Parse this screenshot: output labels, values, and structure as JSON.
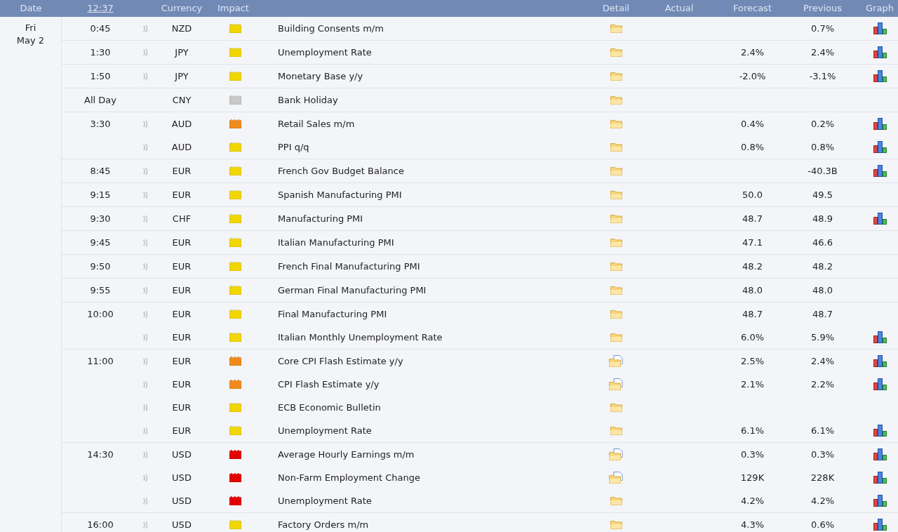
{
  "header": {
    "columns": [
      "Date",
      "12:37",
      "Currency",
      "Impact",
      "Detail",
      "Actual",
      "Forecast",
      "Previous",
      "Graph"
    ]
  },
  "day": {
    "weekday": "Fri",
    "date": "May 2"
  },
  "groups": [
    {
      "time": "0:45",
      "sound": true,
      "events": [
        {
          "currency": "NZD",
          "color": "#f2d600",
          "title": "Building Consents m/m",
          "attachment": false,
          "previous": "0.7%",
          "graph": true
        }
      ]
    },
    {
      "time": "1:30",
      "sound": true,
      "events": [
        {
          "currency": "JPY",
          "color": "#f2d600",
          "title": "Unemployment Rate",
          "attachment": false,
          "forecast": "2.4%",
          "previous": "2.4%",
          "graph": true
        }
      ]
    },
    {
      "time": "1:50",
      "sound": true,
      "events": [
        {
          "currency": "JPY",
          "color": "#f2d600",
          "title": "Monetary Base y/y",
          "attachment": false,
          "forecast": "-2.0%",
          "previous": "-3.1%",
          "graph": true
        }
      ]
    },
    {
      "time": "All Day",
      "sound": false,
      "events": [
        {
          "currency": "CNY",
          "color": "#c8c8c8",
          "title": "Bank Holiday",
          "attachment": false,
          "graph": false
        }
      ]
    },
    {
      "time": "3:30",
      "sound": true,
      "events": [
        {
          "currency": "AUD",
          "color": "#f08a1c",
          "title": "Retail Sales m/m",
          "attachment": false,
          "forecast": "0.4%",
          "previous": "0.2%",
          "graph": true
        },
        {
          "currency": "AUD",
          "color": "#f2d600",
          "title": "PPI q/q",
          "attachment": false,
          "forecast": "0.8%",
          "previous": "0.8%",
          "graph": true
        }
      ]
    },
    {
      "time": "8:45",
      "sound": true,
      "events": [
        {
          "currency": "EUR",
          "color": "#f2d600",
          "title": "French Gov Budget Balance",
          "attachment": false,
          "previous": "-40.3B",
          "graph": true
        }
      ]
    },
    {
      "time": "9:15",
      "sound": true,
      "events": [
        {
          "currency": "EUR",
          "color": "#f2d600",
          "title": "Spanish Manufacturing PMI",
          "attachment": false,
          "forecast": "50.0",
          "previous": "49.5",
          "graph": false
        }
      ]
    },
    {
      "time": "9:30",
      "sound": true,
      "events": [
        {
          "currency": "CHF",
          "color": "#f2d600",
          "title": "Manufacturing PMI",
          "attachment": false,
          "forecast": "48.7",
          "previous": "48.9",
          "graph": true
        }
      ]
    },
    {
      "time": "9:45",
      "sound": true,
      "events": [
        {
          "currency": "EUR",
          "color": "#f2d600",
          "title": "Italian Manufacturing PMI",
          "attachment": false,
          "forecast": "47.1",
          "previous": "46.6",
          "graph": false
        }
      ]
    },
    {
      "time": "9:50",
      "sound": true,
      "events": [
        {
          "currency": "EUR",
          "color": "#f2d600",
          "title": "French Final Manufacturing PMI",
          "attachment": false,
          "forecast": "48.2",
          "previous": "48.2",
          "graph": false
        }
      ]
    },
    {
      "time": "9:55",
      "sound": true,
      "events": [
        {
          "currency": "EUR",
          "color": "#f2d600",
          "title": "German Final Manufacturing PMI",
          "attachment": false,
          "forecast": "48.0",
          "previous": "48.0",
          "graph": false
        }
      ]
    },
    {
      "time": "10:00",
      "sound": true,
      "events": [
        {
          "currency": "EUR",
          "color": "#f2d600",
          "title": "Final Manufacturing PMI",
          "attachment": false,
          "forecast": "48.7",
          "previous": "48.7",
          "graph": false
        },
        {
          "currency": "EUR",
          "color": "#f2d600",
          "title": "Italian Monthly Unemployment Rate",
          "attachment": false,
          "forecast": "6.0%",
          "previous": "5.9%",
          "graph": true
        }
      ]
    },
    {
      "time": "11:00",
      "sound": true,
      "events": [
        {
          "currency": "EUR",
          "color": "#f08a1c",
          "title": "Core CPI Flash Estimate y/y",
          "attachment": true,
          "forecast": "2.5%",
          "previous": "2.4%",
          "graph": true
        },
        {
          "currency": "EUR",
          "color": "#f08a1c",
          "title": "CPI Flash Estimate y/y",
          "attachment": true,
          "forecast": "2.1%",
          "previous": "2.2%",
          "graph": true
        },
        {
          "currency": "EUR",
          "color": "#f2d600",
          "title": "ECB Economic Bulletin",
          "attachment": false,
          "graph": false
        },
        {
          "currency": "EUR",
          "color": "#f2d600",
          "title": "Unemployment Rate",
          "attachment": false,
          "forecast": "6.1%",
          "previous": "6.1%",
          "graph": true
        }
      ]
    },
    {
      "time": "14:30",
      "sound": true,
      "events": [
        {
          "currency": "USD",
          "color": "#e30000",
          "title": "Average Hourly Earnings m/m",
          "attachment": true,
          "forecast": "0.3%",
          "previous": "0.3%",
          "graph": true
        },
        {
          "currency": "USD",
          "color": "#e30000",
          "title": "Non-Farm Employment Change",
          "attachment": true,
          "forecast": "129K",
          "previous": "228K",
          "graph": true
        },
        {
          "currency": "USD",
          "color": "#e30000",
          "title": "Unemployment Rate",
          "attachment": false,
          "forecast": "4.2%",
          "previous": "4.2%",
          "graph": true
        }
      ]
    },
    {
      "time": "16:00",
      "sound": true,
      "events": [
        {
          "currency": "USD",
          "color": "#f2d600",
          "title": "Factory Orders m/m",
          "attachment": false,
          "forecast": "4.3%",
          "previous": "0.6%",
          "graph": true
        }
      ]
    }
  ]
}
